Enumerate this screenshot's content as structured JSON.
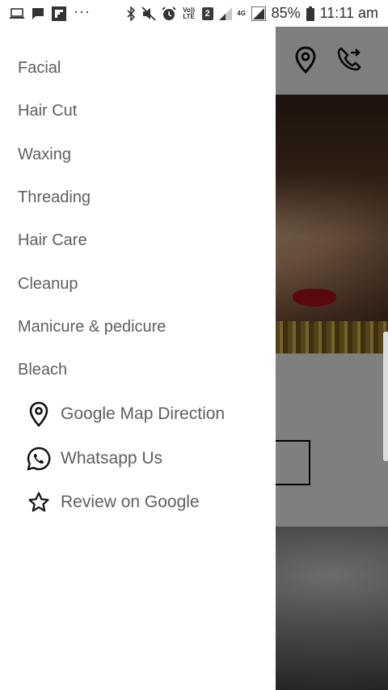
{
  "status_bar": {
    "battery_percent": "85%",
    "time": "11:11 am",
    "volte_label": "Vo)) LTE",
    "sim_slot": "2",
    "network_type": "4G"
  },
  "menu": {
    "items": [
      {
        "label": "Facial"
      },
      {
        "label": "Hair Cut"
      },
      {
        "label": "Waxing"
      },
      {
        "label": "Threading"
      },
      {
        "label": "Hair Care"
      },
      {
        "label": "Cleanup"
      },
      {
        "label": "Manicure & pedicure"
      },
      {
        "label": "Bleach"
      }
    ],
    "actions": [
      {
        "label": "Google Map Direction",
        "icon": "map-pin-icon"
      },
      {
        "label": "Whatsapp Us",
        "icon": "whatsapp-icon"
      },
      {
        "label": "Review on Google",
        "icon": "star-outline-icon"
      }
    ]
  },
  "background_app": {
    "toolbar_icons": [
      "location-pin-icon",
      "phone-forward-icon"
    ]
  },
  "colors": {
    "drawer_background": "#ffffff",
    "menu_text": "#5f5f5f",
    "scrim": "rgba(0,0,0,0.5)"
  }
}
